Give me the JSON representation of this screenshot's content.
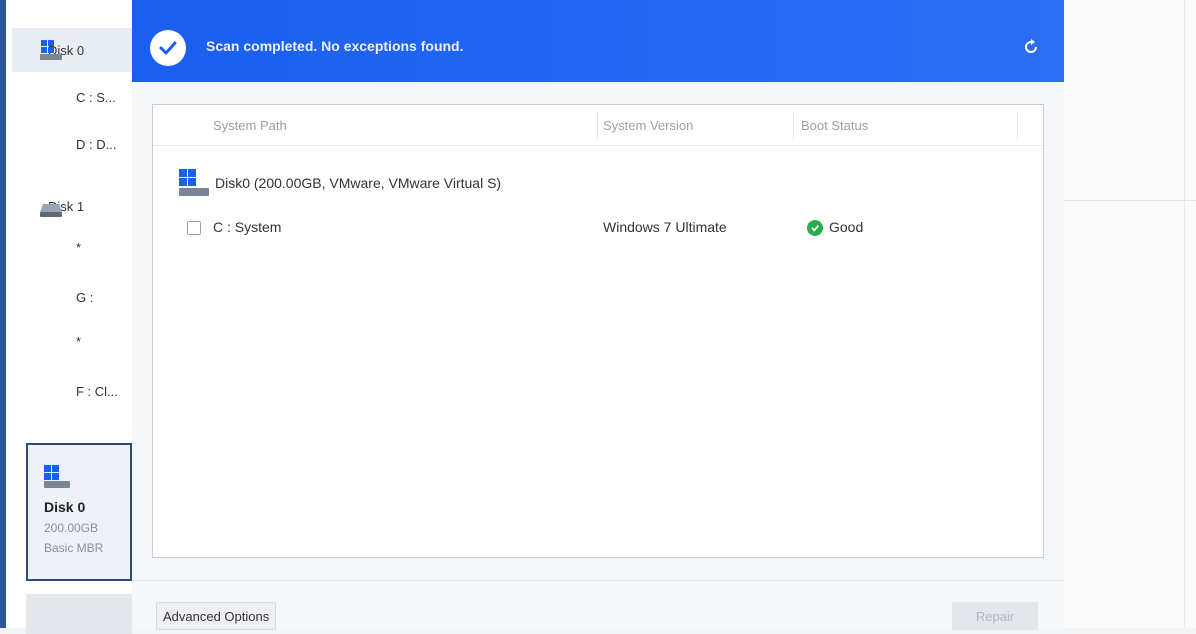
{
  "sidebar": {
    "disks": [
      {
        "label": "Disk 0",
        "partitions": [
          "C : S...",
          "D : D..."
        ]
      },
      {
        "label": "Disk 1",
        "partitions": [
          "*",
          "G :",
          "*",
          "F : Cl..."
        ]
      }
    ],
    "card": {
      "name": "Disk 0",
      "size": "200.00GB",
      "type": "Basic MBR"
    }
  },
  "dialog": {
    "banner_text": "Scan completed. No exceptions found.",
    "table": {
      "columns": [
        "System Path",
        "System Version",
        "Boot Status"
      ],
      "disk_label": "Disk0 (200.00GB, VMware, VMware Virtual S)",
      "rows": [
        {
          "path": "C : System",
          "version": "Windows 7 Ultimate",
          "status": "Good"
        }
      ]
    },
    "buttons": {
      "advanced": "Advanced Options",
      "repair": "Repair"
    }
  },
  "colors": {
    "banner": "#1a5ff0",
    "good": "#2cab55"
  }
}
